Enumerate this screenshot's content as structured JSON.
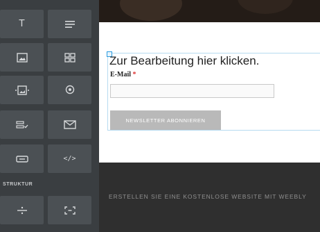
{
  "sidebar": {
    "section_label": "STRUKTUR",
    "tiles": [
      {
        "icon": "text-icon",
        "glyph": "T"
      },
      {
        "icon": "paragraph-icon"
      },
      {
        "icon": "image-icon"
      },
      {
        "icon": "gallery-icon"
      },
      {
        "icon": "slideshow-icon"
      },
      {
        "icon": "map-icon"
      },
      {
        "icon": "form-icon"
      },
      {
        "icon": "newsletter-icon"
      },
      {
        "icon": "button-icon"
      },
      {
        "icon": "embed-code-icon",
        "glyph": "</>"
      },
      {
        "icon": "divider-icon"
      },
      {
        "icon": "spacer-icon"
      }
    ]
  },
  "editor": {
    "form_title": "Zur Bearbeitung hier klicken.",
    "email_label": "E-Mail",
    "required_marker": "*",
    "submit_label": "NEWSLETTER ABONNIEREN",
    "footer_text": "ERSTELLEN SIE EINE KOSTENLOSE WEBSITE MIT WEEBLY"
  },
  "colors": {
    "sidebar_bg": "#3a3e41",
    "tile_bg": "#4b5054",
    "accent": "#2a9be0",
    "button_bg": "#b9b9b9",
    "footer_bg": "#2f2f2f"
  }
}
